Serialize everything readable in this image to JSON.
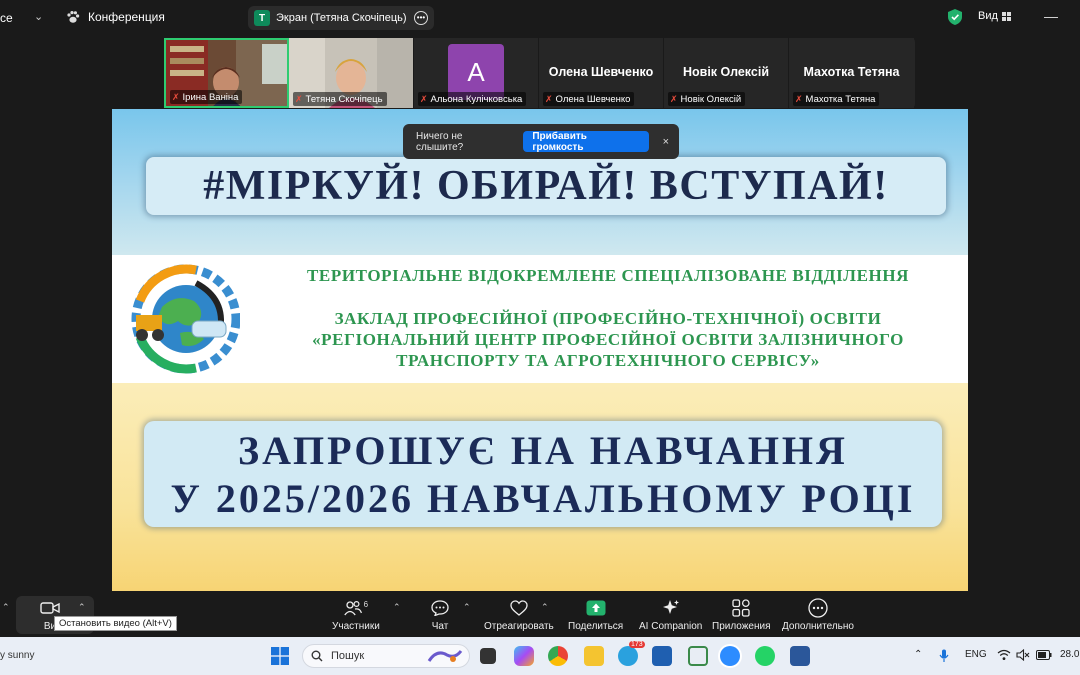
{
  "topbar": {
    "app_name": "ce",
    "meeting_label": "Конференция",
    "share_badge": "T",
    "share_title": "Экран (Тетяна Скочіпець)",
    "view_label": "Вид"
  },
  "participants": [
    {
      "name": "Ірина Ваніна",
      "muted": true,
      "has_video": true,
      "active": true
    },
    {
      "name": "Тетяна Скочіпець",
      "muted": true,
      "has_video": true
    },
    {
      "name": "Альона Кулічковська",
      "muted": true,
      "avatar_letter": "A"
    },
    {
      "name": "Олена Шевченко",
      "muted": true,
      "display_name": "Олена Шевченко"
    },
    {
      "name": "Новік Олексій",
      "muted": true,
      "display_name": "Новік Олексій"
    },
    {
      "name": "Махотка Тетяна",
      "muted": true,
      "display_name": "Махотка Тетяна"
    }
  ],
  "notification": {
    "text": "Ничего не слышите?",
    "button": "Прибавить громкость",
    "close": "×"
  },
  "slide": {
    "slogan": "#МІРКУЙ! ОБИРАЙ! ВСТУПАЙ!",
    "org_line1": "ТЕРИТОРІАЛЬНЕ ВІДОКРЕМЛЕНЕ СПЕЦІАЛІЗОВАНЕ ВІДДІЛЕННЯ",
    "org_line2": "ЗАКЛАД ПРОФЕСІЙНОЇ (ПРОФЕСІЙНО-ТЕХНІЧНОЇ) ОСВІТИ",
    "org_line3": "«РЕГІОНАЛЬНИЙ ЦЕНТР ПРОФЕСІЙНОЇ ОСВІТИ ЗАЛІЗНИЧНОГО",
    "org_line4": "ТРАНСПОРТУ ТА АГРОТЕХНІЧНОГО СЕРВІСУ»",
    "invite_line1": "ЗАПРОШУЄ НА НАВЧАННЯ",
    "invite_line2": "У 2025/2026 НАВЧАЛЬНОМУ РОЦІ"
  },
  "toolbar": {
    "video_label": "Ви",
    "video_tooltip": "Остановить видео (Alt+V)",
    "participants_label": "Участники",
    "participants_count": "6",
    "chat_label": "Чат",
    "react_label": "Отреагировать",
    "share_label": "Поделиться",
    "ai_label": "AI Companion",
    "apps_label": "Приложения",
    "more_label": "Дополнительно"
  },
  "taskbar": {
    "weather": "y sunny",
    "search_placeholder": "Пошук",
    "language": "ENG",
    "date_fragment": "28.0",
    "telegram_badge": "173"
  },
  "colors": {
    "accent_blue": "#0e71eb",
    "active_green": "#2ecc71",
    "org_green": "#2d9650",
    "slide_navy": "#1b2b58"
  }
}
